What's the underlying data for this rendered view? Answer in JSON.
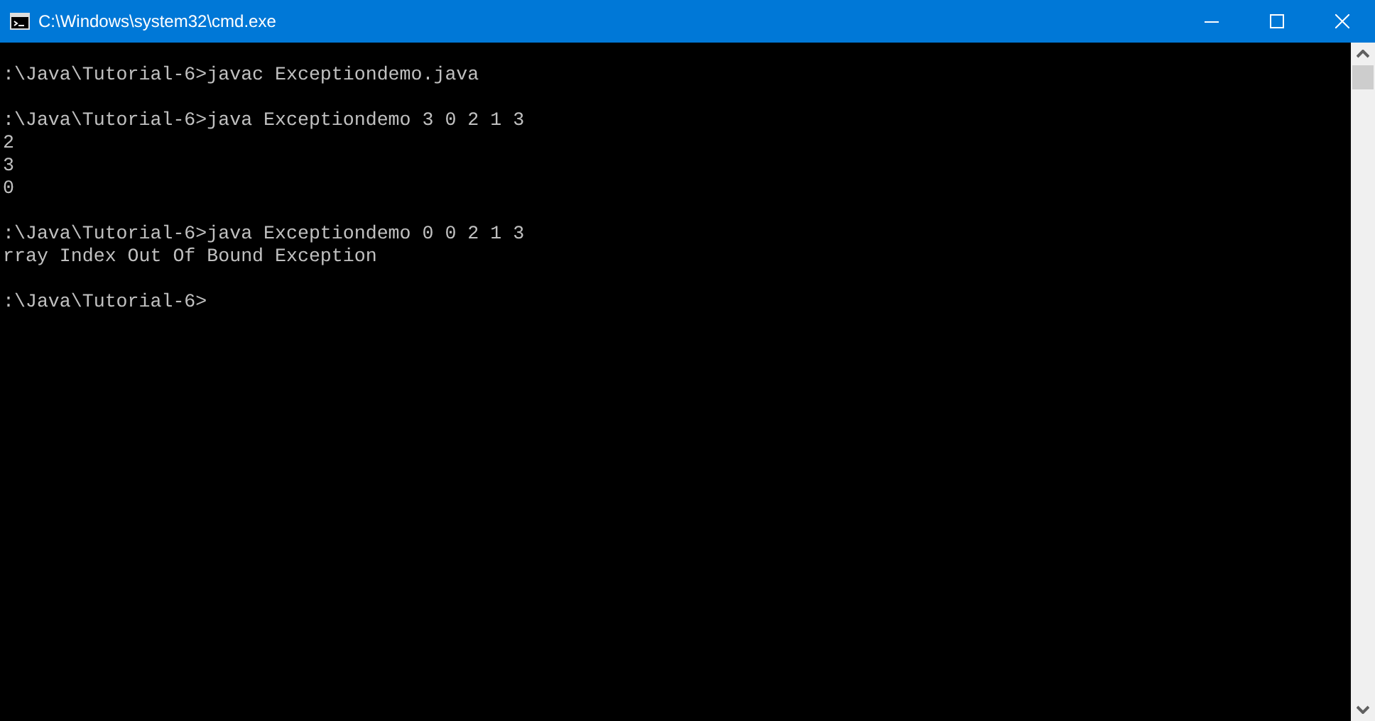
{
  "window": {
    "title": "C:\\Windows\\system32\\cmd.exe"
  },
  "console": {
    "blocks": [
      {
        "lines": [
          ":\\Java\\Tutorial-6>javac Exceptiondemo.java"
        ]
      },
      {
        "lines": [
          ":\\Java\\Tutorial-6>java Exceptiondemo 3 0 2 1 3",
          "2",
          "3",
          "0"
        ]
      },
      {
        "lines": [
          ":\\Java\\Tutorial-6>java Exceptiondemo 0 0 2 1 3",
          "rray Index Out Of Bound Exception"
        ]
      },
      {
        "lines": [
          ":\\Java\\Tutorial-6>"
        ]
      }
    ]
  }
}
